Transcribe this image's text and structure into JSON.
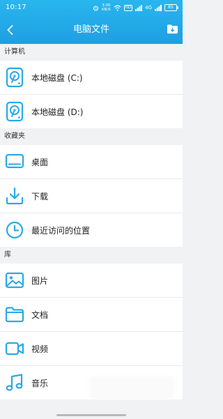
{
  "status_bar": {
    "time": "10:17",
    "net_speed_value": "3.00",
    "net_speed_unit": "KB/S",
    "hd_label": "HD",
    "signal_label": "4G",
    "battery": "85"
  },
  "header": {
    "title": "电脑文件",
    "accent_color": "#1e9fe3"
  },
  "sections": {
    "computer": {
      "title": "计算机",
      "items": [
        {
          "label": "本地磁盘 (C:)",
          "icon": "hard-drive-icon"
        },
        {
          "label": "本地磁盘 (D:)",
          "icon": "hard-drive-icon"
        }
      ]
    },
    "favorites": {
      "title": "收藏夹",
      "items": [
        {
          "label": "桌面",
          "icon": "desktop-icon"
        },
        {
          "label": "下载",
          "icon": "download-icon"
        },
        {
          "label": "最近访问的位置",
          "icon": "clock-icon"
        }
      ]
    },
    "library": {
      "title": "库",
      "items": [
        {
          "label": "图片",
          "icon": "image-icon"
        },
        {
          "label": "文档",
          "icon": "folder-icon"
        },
        {
          "label": "视频",
          "icon": "video-icon"
        },
        {
          "label": "音乐",
          "icon": "music-icon"
        }
      ]
    }
  }
}
